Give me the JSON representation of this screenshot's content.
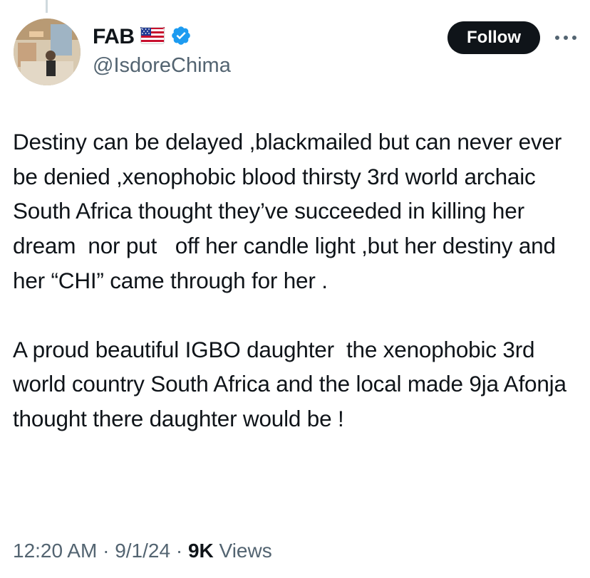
{
  "author": {
    "display_name": "FAB",
    "flag_emoji": "🇺🇸",
    "handle": "@IsdoreChima",
    "verified": true
  },
  "actions": {
    "follow_label": "Follow",
    "more_icon": "more-horizontal-icon"
  },
  "post": {
    "paragraphs": [
      "Destiny can be delayed ,blackmailed but can never ever be denied ,xenophobic blood thirsty 3rd world archaic South Africa thought they’ve succeeded in killing her dream  nor put   off her candle light ,but her destiny and her “CHI” came through for her .",
      "A proud beautiful IGBO daughter  the xenophobic 3rd world country South Africa and the local made 9ja Afonja thought there daughter would be !"
    ]
  },
  "meta": {
    "time": "12:20 AM",
    "separator": " · ",
    "date": "9/1/24",
    "views_count": "9K",
    "views_label": "Views"
  },
  "colors": {
    "verified_badge": "#1d9bf0",
    "follow_button_bg": "#0f1419",
    "secondary_text": "#536471"
  }
}
